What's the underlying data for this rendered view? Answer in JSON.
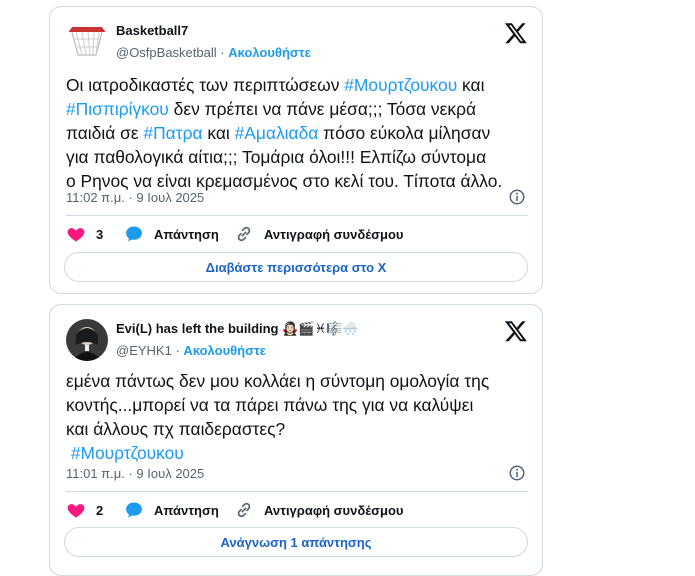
{
  "tweets": [
    {
      "author_name": "Basketball7",
      "author_handle": "@OsfpBasketball",
      "follow_label": "Ακολουθήστε",
      "text_parts": [
        {
          "t": "Οι ιατροδικαστές των περιπτώσεων ",
          "tag": false
        },
        {
          "t": "#Μουρτζουκου",
          "tag": true
        },
        {
          "t": " και\n",
          "tag": false
        },
        {
          "t": "#Πισπιρίγκου",
          "tag": true
        },
        {
          "t": " δεν πρέπει να πάνε μέσα;;; Τόσα νεκρά\nπαιδιά σε ",
          "tag": false
        },
        {
          "t": "#Πατρα",
          "tag": true
        },
        {
          "t": " και ",
          "tag": false
        },
        {
          "t": "#Αμαλιαδα",
          "tag": true
        },
        {
          "t": " πόσο εύκολα μίλησαν\nγια παθολογικά αίτια;;; Τομάρια όλοι!!! Ελπίζω σύντομα\nο Ρηνος να είναι κρεμασμένος στο κελί του. Τίποτα άλλο.",
          "tag": false
        }
      ],
      "timestamp": "11:02 π.μ. · 9 Ιουλ 2025",
      "likes": "3",
      "reply_label": "Απάντηση",
      "copy_link_label": "Αντιγραφή συνδέσμου",
      "bottom_button": "Διαβάστε περισσότερα στο X"
    },
    {
      "author_name": "Evi(L) has left the building 🧛🏻‍♀️🎬♓🎼🌨️",
      "author_handle": "@EYHK1",
      "follow_label": "Ακολουθήστε",
      "text_parts": [
        {
          "t": "εμένα πάντως δεν μου κολλάει η σύντομη ομολογία της\nκοντής...μπορεί να τα πάρει πάνω της για να καλύψει\nκαι άλλους πχ παιδεραστες?\n ",
          "tag": false
        },
        {
          "t": "#Μουρτζουκου",
          "tag": true
        }
      ],
      "timestamp": "11:01 π.μ. · 9 Ιουλ 2025",
      "likes": "2",
      "reply_label": "Απάντηση",
      "copy_link_label": "Αντιγραφή συνδέσμου",
      "bottom_button": "Ανάγνωση 1 απάντησης"
    }
  ],
  "colors": {
    "accent": "#1d9bf0",
    "like": "#f91880",
    "muted": "#536471",
    "border": "#cfd9de"
  },
  "icons": [
    "basketball-hoop-avatar",
    "x-logo-icon",
    "info-icon",
    "heart-icon",
    "reply-bubble-icon",
    "link-icon"
  ]
}
